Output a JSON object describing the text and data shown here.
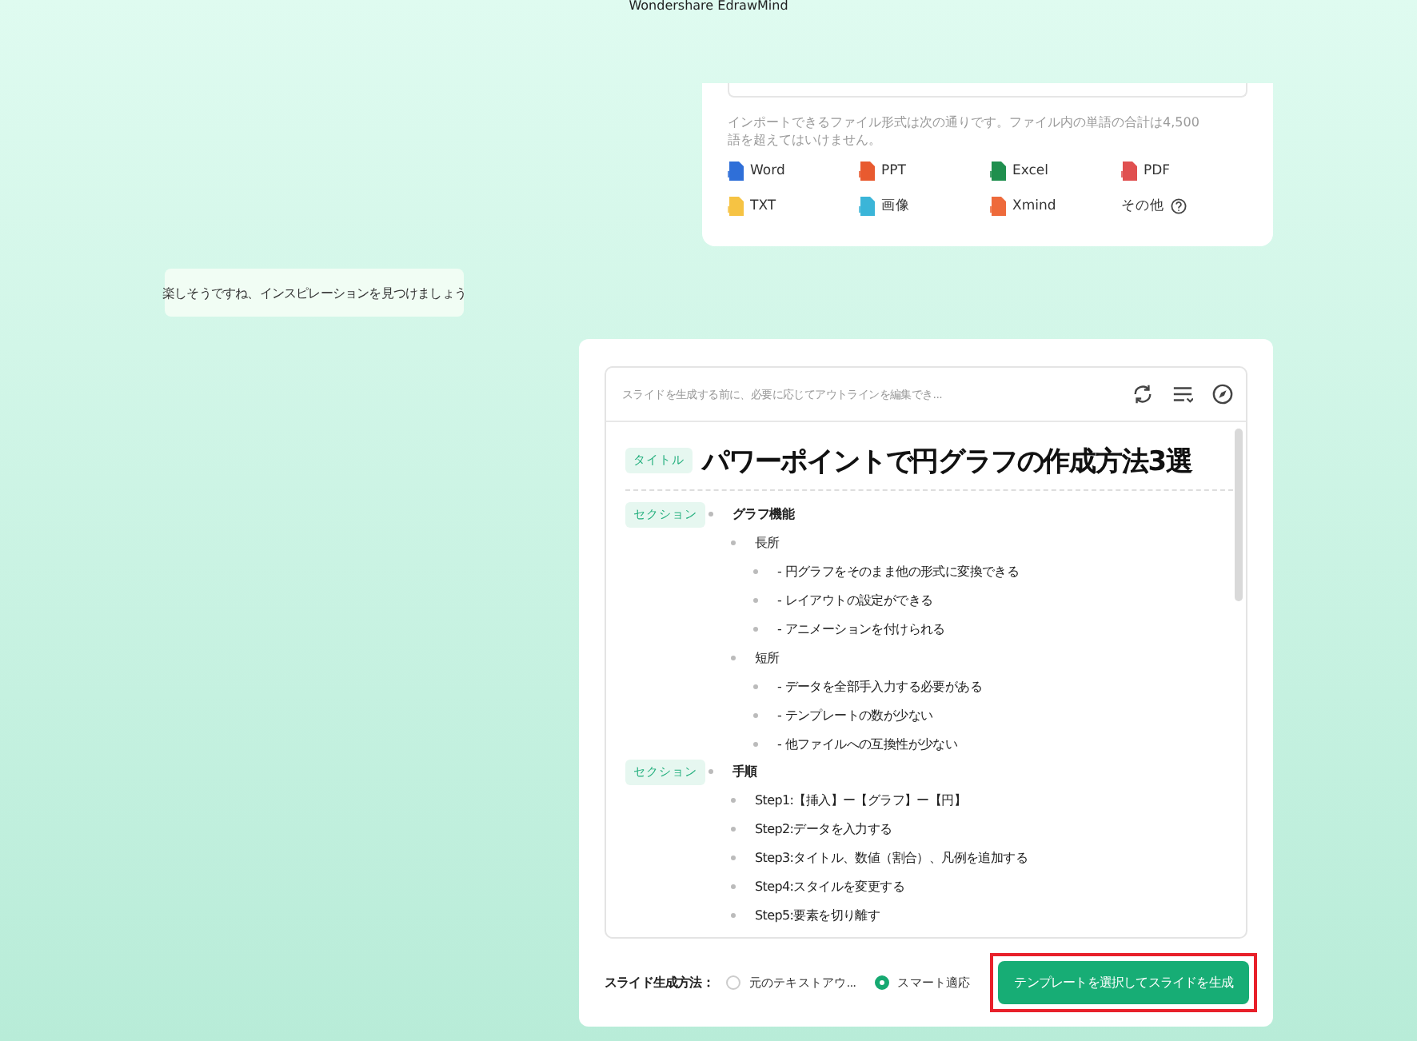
{
  "app_title": "Wondershare EdrawMind",
  "import_panel": {
    "note": "インポートできるファイル形式は次の通りです。ファイル内の単語の合計は4,500語を超えてはいけません。",
    "formats": [
      {
        "label": "Word",
        "kind": "word"
      },
      {
        "label": "PPT",
        "kind": "ppt"
      },
      {
        "label": "Excel",
        "kind": "excel"
      },
      {
        "label": "PDF",
        "kind": "pdf"
      },
      {
        "label": "TXT",
        "kind": "txt"
      },
      {
        "label": "画像",
        "kind": "image"
      },
      {
        "label": "Xmind",
        "kind": "xmind"
      },
      {
        "label": "その他",
        "kind": "other"
      }
    ]
  },
  "chat_message": "楽しそうですね、インスピレーションを見つけましょう",
  "outline": {
    "placeholder": "スライドを生成する前に、必要に応じてアウトラインを編集でき...",
    "title": {
      "tag": "タイトル",
      "text": "パワーポイントで円グラフの作成方法3選"
    },
    "sections": [
      {
        "tag": "セクション",
        "text": "グラフ機能",
        "children": [
          {
            "text": "長所",
            "children": [
              {
                "text": "- 円グラフをそのまま他の形式に変換できる"
              },
              {
                "text": "- レイアウトの設定ができる"
              },
              {
                "text": "- アニメーションを付けられる"
              }
            ]
          },
          {
            "text": "短所",
            "children": [
              {
                "text": "- データを全部手入力する必要がある"
              },
              {
                "text": "- テンプレートの数が少ない"
              },
              {
                "text": "- 他ファイルへの互換性が少ない"
              }
            ]
          }
        ]
      },
      {
        "tag": "セクション",
        "text": "手順",
        "children": [
          {
            "text": "Step1:【挿入】ー【グラフ】ー【円】"
          },
          {
            "text": "Step2:データを入力する"
          },
          {
            "text": "Step3:タイトル、数値（割合）、凡例を追加する"
          },
          {
            "text": "Step4:スタイルを変更する"
          },
          {
            "text": "Step5:要素を切り離す"
          }
        ]
      }
    ]
  },
  "generation": {
    "label": "スライド生成方法：",
    "options": [
      {
        "label": "元のテキストアウ...",
        "selected": false
      },
      {
        "label": "スマート適応",
        "selected": true
      }
    ],
    "button": {
      "label": "テンプレートを選択してスライドを生成",
      "highlighted": true
    }
  }
}
